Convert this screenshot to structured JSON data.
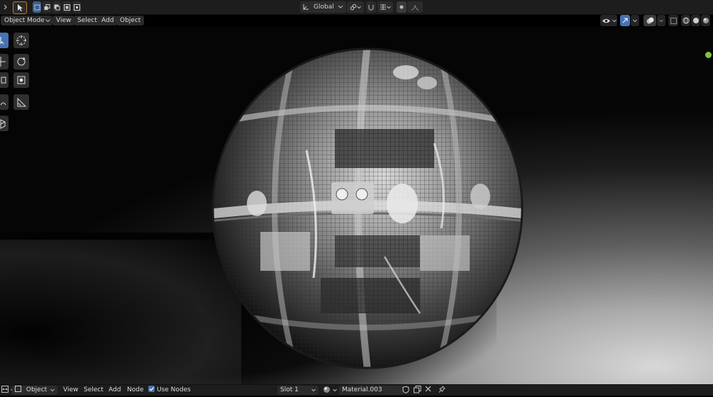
{
  "header": {
    "transform_orientation": "Global",
    "object_mode": "Object Mode",
    "menu": [
      "View",
      "Select",
      "Add",
      "Object"
    ]
  },
  "viewport": {
    "subject": "Sci-fi greeble sphere"
  },
  "footer": {
    "editor_type": "Object",
    "menu": [
      "View",
      "Select",
      "Add",
      "Node"
    ],
    "use_nodes_label": "Use Nodes",
    "use_nodes_checked": true,
    "slot": "Slot 1",
    "material": "Material.003"
  },
  "colors": {
    "accent": "#4772b3",
    "header_bg": "#1d1d1d",
    "gizmo_y": "#7fc240"
  }
}
